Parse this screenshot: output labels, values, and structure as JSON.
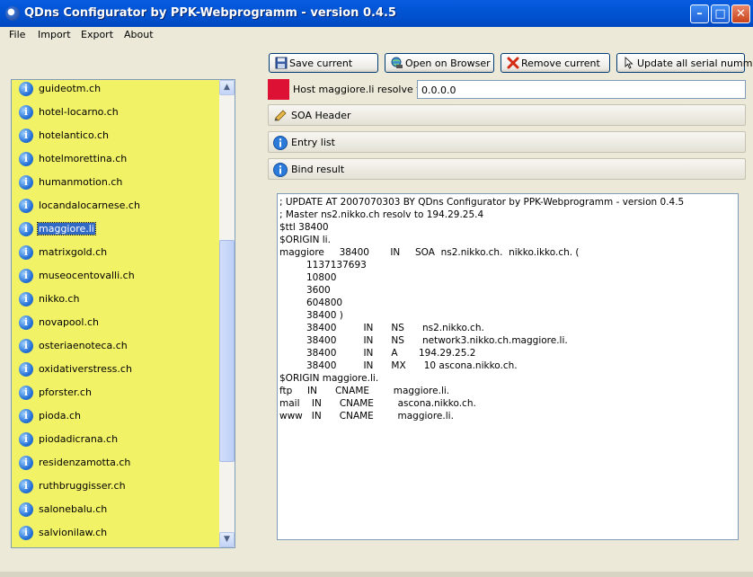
{
  "window": {
    "title": "QDns Configurator by PPK-Webprogramm - version 0.4.5"
  },
  "menu": [
    "File",
    "Import",
    "Export",
    "About"
  ],
  "toolbar": {
    "save_label": "Save current",
    "browser_label": "Open on Browser",
    "remove_label": "Remove current",
    "update_label": "Update all serial nummer"
  },
  "domains": [
    "guideotm.ch",
    "hotel-locarno.ch",
    "hotelantico.ch",
    "hotelmorettina.ch",
    "humanmotion.ch",
    "locandalocarnese.ch",
    "maggiore.li",
    "matrixgold.ch",
    "museocentovalli.ch",
    "nikko.ch",
    "novapool.ch",
    "osteriaenoteca.ch",
    "oxidativerstress.ch",
    "pforster.ch",
    "pioda.ch",
    "piodadicrana.ch",
    "residenzamotta.ch",
    "ruthbruggisser.ch",
    "salonebalu.ch",
    "salvionilaw.ch"
  ],
  "selected_domain": "maggiore.li",
  "host": {
    "label": "Host maggiore.li resolve to:",
    "value": "0.0.0.0",
    "status_color": "#dd1133"
  },
  "sections": {
    "soa": "SOA Header",
    "entries": "Entry list",
    "bind": "Bind result"
  },
  "bind_result": [
    {
      "indent": 0,
      "text": "; UPDATE AT 2007070303 BY QDns Configurator by PPK-Webprogramm - version 0.4.5"
    },
    {
      "indent": 0,
      "text": "; Master ns2.nikko.ch resolv to 194.29.25.4"
    },
    {
      "indent": 0,
      "text": "$ttl 38400"
    },
    {
      "indent": 0,
      "text": "$ORIGIN li."
    },
    {
      "indent": 0,
      "text": "maggiore     38400       IN     SOA  ns2.nikko.ch.  nikko.ikko.ch. ("
    },
    {
      "indent": 1,
      "text": "1137137693"
    },
    {
      "indent": 2,
      "text": "10800"
    },
    {
      "indent": 2,
      "text": "3600"
    },
    {
      "indent": 2,
      "text": "604800"
    },
    {
      "indent": 2,
      "text": "38400 )"
    },
    {
      "indent": 2,
      "text": "38400         IN      NS      ns2.nikko.ch."
    },
    {
      "indent": 2,
      "text": "38400         IN      NS      network3.nikko.ch.maggiore.li."
    },
    {
      "indent": 2,
      "text": "38400         IN      A       194.29.25.2"
    },
    {
      "indent": 2,
      "text": "38400         IN      MX      10 ascona.nikko.ch."
    },
    {
      "indent": 0,
      "text": "$ORIGIN maggiore.li."
    },
    {
      "indent": 0,
      "text": "ftp     IN      CNAME        maggiore.li."
    },
    {
      "indent": 0,
      "text": "mail    IN      CNAME        ascona.nikko.ch."
    },
    {
      "indent": 0,
      "text": "www   IN      CNAME        maggiore.li."
    }
  ],
  "colors": {
    "titlebar": "#0256d6",
    "list_background": "#f2f266",
    "selection": "#316ac5"
  }
}
